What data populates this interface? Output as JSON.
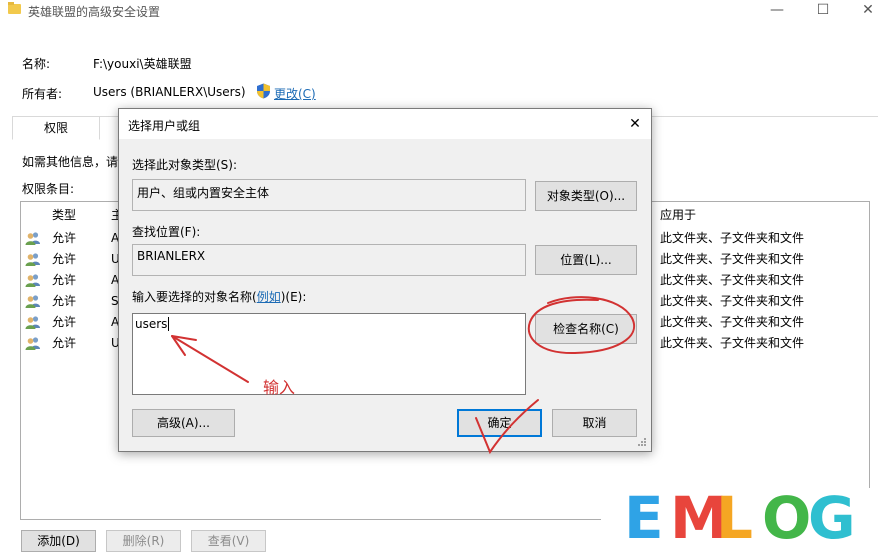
{
  "window": {
    "title": "英雄联盟的高级安全设置",
    "min_glyph": "—",
    "max_glyph": "☐",
    "close_glyph": "✕"
  },
  "props": {
    "name_label": "名称:",
    "name_value": "F:\\youxi\\英雄联盟",
    "owner_label": "所有者:",
    "owner_value": "Users (BRIANLERX\\Users)",
    "change_link": "更改(C)"
  },
  "tabs": {
    "permissions": "权限"
  },
  "info_text": "如需其他信息，请",
  "entries_label": "权限条目:",
  "list": {
    "headers": {
      "type": "类型",
      "principal": "主",
      "applies_to": "应用于"
    },
    "rows": [
      {
        "type": "允许",
        "principal": "A",
        "applies": "此文件夹、子文件夹和文件"
      },
      {
        "type": "允许",
        "principal": "U",
        "applies": "此文件夹、子文件夹和文件"
      },
      {
        "type": "允许",
        "principal": "A",
        "applies": "此文件夹、子文件夹和文件"
      },
      {
        "type": "允许",
        "principal": "S",
        "applies": "此文件夹、子文件夹和文件"
      },
      {
        "type": "允许",
        "principal": "A",
        "applies": "此文件夹、子文件夹和文件"
      },
      {
        "type": "允许",
        "principal": "U",
        "applies": "此文件夹、子文件夹和文件"
      }
    ]
  },
  "bottom_buttons": {
    "add": "添加(D)",
    "remove": "删除(R)",
    "view": "查看(V)"
  },
  "dialog": {
    "title": "选择用户或组",
    "close_glyph": "✕",
    "object_type_label": "选择此对象类型(S):",
    "object_type_value": "用户、组或内置安全主体",
    "object_type_button": "对象类型(O)...",
    "location_label": "查找位置(F):",
    "location_value": "BRIANLERX",
    "location_button": "位置(L)...",
    "enter_label_pre": "输入要选择的对象名称(",
    "enter_label_link": "例如",
    "enter_label_post": ")(E):",
    "input_value": "users",
    "check_names_button": "检查名称(C)",
    "advanced_button": "高级(A)...",
    "ok_button": "确定",
    "cancel_button": "取消"
  },
  "annotation": {
    "text": "输入",
    "color": "#d23232"
  },
  "watermark": {
    "letters": [
      "E",
      "M",
      "L",
      "O",
      "G"
    ],
    "colors": [
      "#2fa3e6",
      "#e8453c",
      "#f5a623",
      "#43b649",
      "#2fbfd0"
    ]
  }
}
